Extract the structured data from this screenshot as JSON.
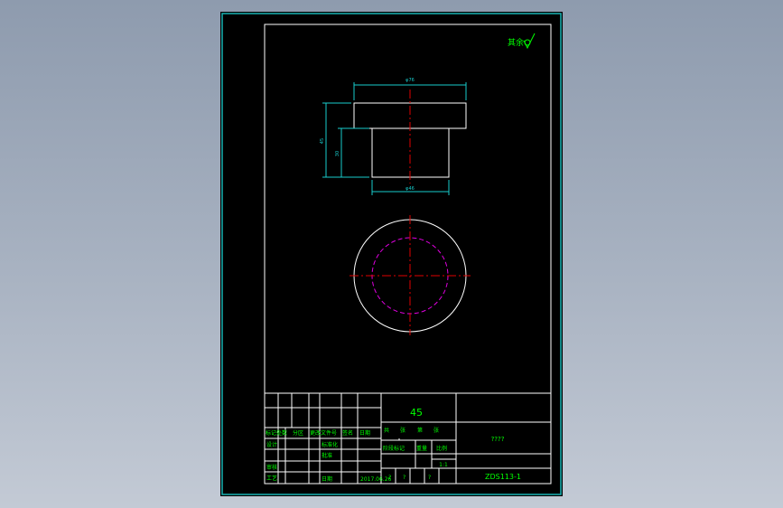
{
  "colors": {
    "background": "#000000",
    "outer_frame": "#19b3b3",
    "inner_frame": "#ffffff",
    "geometry": "#ffffff",
    "dimension": "#19cccc",
    "center_line": "#e00000",
    "hidden_line": "#e000e0",
    "title_text": "#00ff00",
    "roughness_mark": "#00ff00"
  },
  "roughness_note": "其余",
  "dimensions": {
    "top_diameter": "φ76",
    "total_height": "45",
    "body_height": "30",
    "body_diameter": "φ46"
  },
  "title_block": {
    "material": "45",
    "part_name": "????",
    "drawing_number": "ZDS113-1",
    "date": "2017.06.26",
    "scale": "1:1",
    "revision_headers": [
      "标记",
      "处数",
      "分区",
      "更改文件号",
      "签名",
      "日期"
    ],
    "role_labels": [
      "设计",
      "审核",
      "工艺"
    ],
    "mid_labels": [
      "标准化",
      "批准",
      "日期"
    ],
    "stage_headers": [
      "阶段标记",
      "重量",
      "比例"
    ],
    "sheet_labels": [
      "共",
      "张",
      "第",
      "张"
    ],
    "placeholders": [
      "?",
      "?",
      "?"
    ]
  }
}
